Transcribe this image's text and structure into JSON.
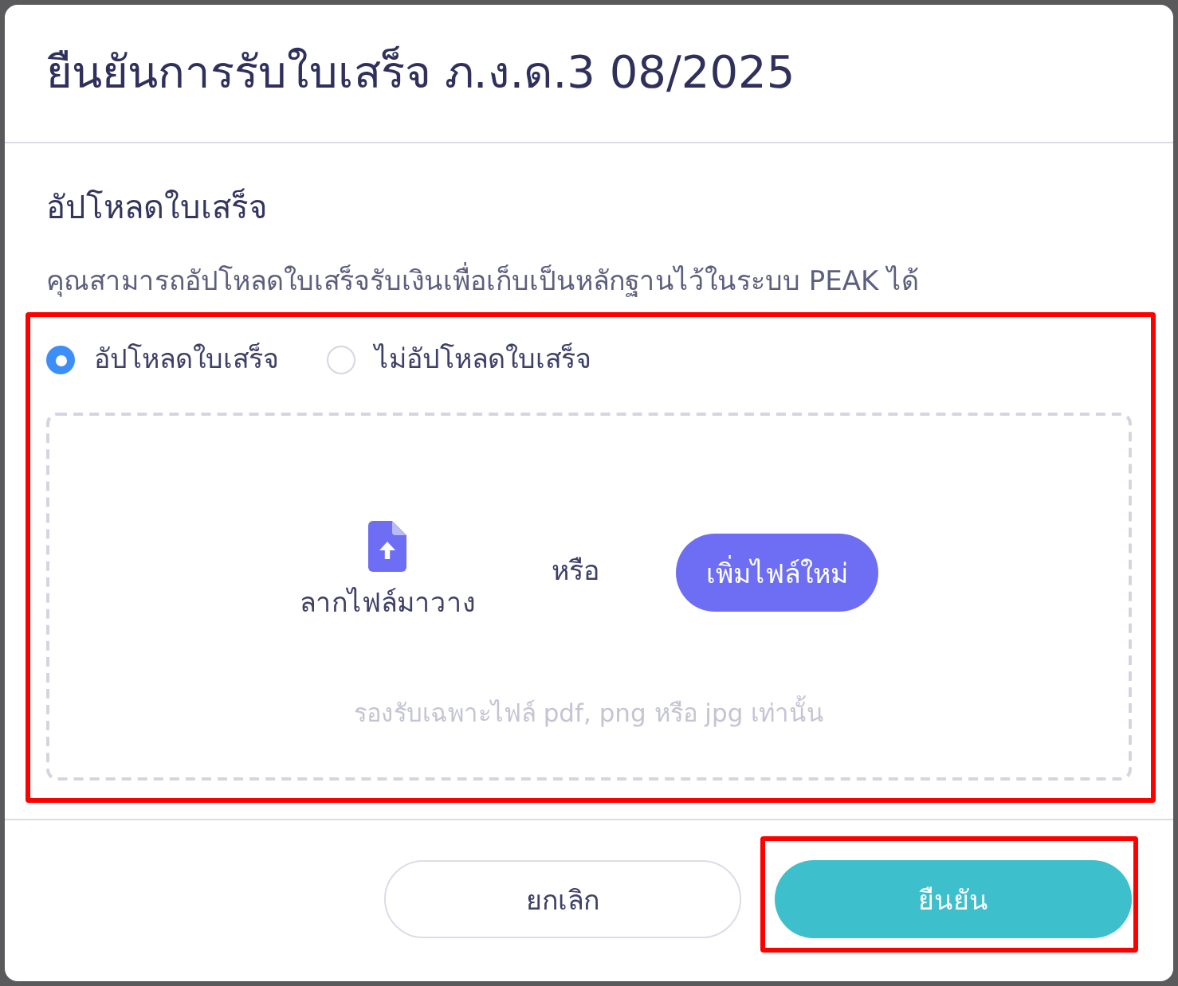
{
  "dialog": {
    "title": "ยืนยันการรับใบเสร็จ ภ.ง.ด.3 08/2025"
  },
  "upload_section": {
    "heading": "อัปโหลดใบเสร็จ",
    "description": "คุณสามารถอัปโหลดใบเสร็จรับเงินเพื่อเก็บเป็นหลักฐานไว้ในระบบ PEAK ได้",
    "highlighted": true,
    "options": [
      {
        "label": "อัปโหลดใบเสร็จ",
        "selected": true
      },
      {
        "label": "ไม่อัปโหลดใบเสร็จ",
        "selected": false
      }
    ],
    "dropzone": {
      "drag_text": "ลากไฟล์มาวาง",
      "or_text": "หรือ",
      "add_button": "เพิ่มไฟล์ใหม่",
      "hint": "รองรับเฉพาะไฟล์ pdf, png หรือ jpg เท่านั้น"
    }
  },
  "buttons": [
    {
      "label": "ยกเลิก",
      "kind": "secondary",
      "highlighted": false
    },
    {
      "label": "ยืนยัน",
      "kind": "primary",
      "highlighted": true
    }
  ]
}
